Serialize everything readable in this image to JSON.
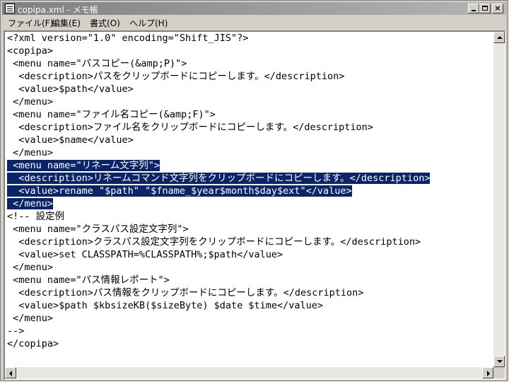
{
  "window": {
    "title": "copipa.xml - メモ帳",
    "icon": "notepad-icon",
    "controls": {
      "minimize_icon": "minimize-icon",
      "maximize_icon": "maximize-icon",
      "close_label": "×"
    }
  },
  "menubar": {
    "items": [
      {
        "label": "ファイル(F)"
      },
      {
        "label": "編集(E)"
      },
      {
        "label": "書式(O)"
      },
      {
        "label": "ヘルプ(H)"
      }
    ]
  },
  "editor": {
    "lines": [
      "<?xml version=\"1.0\" encoding=\"Shift_JIS\"?>",
      "<copipa>",
      " <menu name=\"パスコピー(&amp;P)\">",
      "  <description>パスをクリップボードにコピーします。</description>",
      "  <value>$path</value>",
      " </menu>",
      " <menu name=\"ファイル名コピー(&amp;F)\">",
      "  <description>ファイル名をクリップボードにコピーします。</description>",
      "  <value>$name</value>",
      " </menu>",
      " <menu name=\"リネーム文字列\">",
      "  <description>リネームコマンド文字列をクリップボードにコピーします。</description>",
      "  <value>rename \"$path\" \"$fname_$year$month$day$ext\"</value>",
      " </menu>",
      "<!-- 設定例",
      " <menu name=\"クラスパス設定文字列\">",
      "  <description>クラスパス設定文字列をクリップボードにコピーします。</description>",
      "  <value>set CLASSPATH=%CLASSPATH%;$path</value>",
      " </menu>",
      " <menu name=\"パス情報レポート\">",
      "  <description>パス情報をクリップボードにコピーします。</description>",
      "  <value>$path $kbsizeKB($sizeByte) $date $time</value>",
      " </menu>",
      "-->",
      "</copipa>"
    ],
    "selected_lines": [
      10,
      11,
      12,
      13
    ],
    "selection_color": "#0a246a"
  }
}
